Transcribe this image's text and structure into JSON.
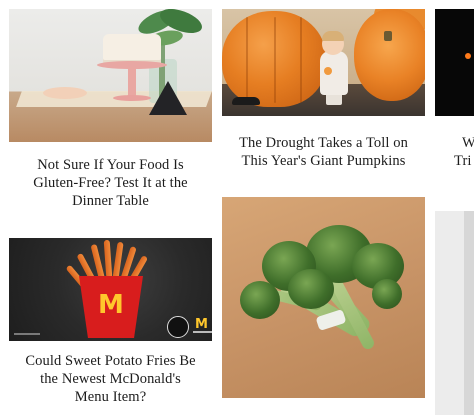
{
  "articles": [
    {
      "title_lines": [
        "Not Sure If Your Food Is",
        "Gluten-Free? Test It at the",
        "Dinner Table"
      ]
    },
    {
      "title_lines": [
        "The Drought Takes a Toll on",
        "This Year's Giant Pumpkins"
      ]
    },
    {
      "title_lines": [
        "W",
        "Tri"
      ]
    },
    {
      "title_lines": [
        "Could Sweet Potato Fries Be",
        "the Newest McDonald's",
        "Menu Item?"
      ],
      "logo_text": "M"
    },
    {
      "title_lines": []
    },
    {
      "title_lines": []
    }
  ],
  "colors": {
    "accent_orange": "#e67e22",
    "mcdonalds_red": "#d81d1d",
    "mcdonalds_yellow": "#ffc72c"
  }
}
